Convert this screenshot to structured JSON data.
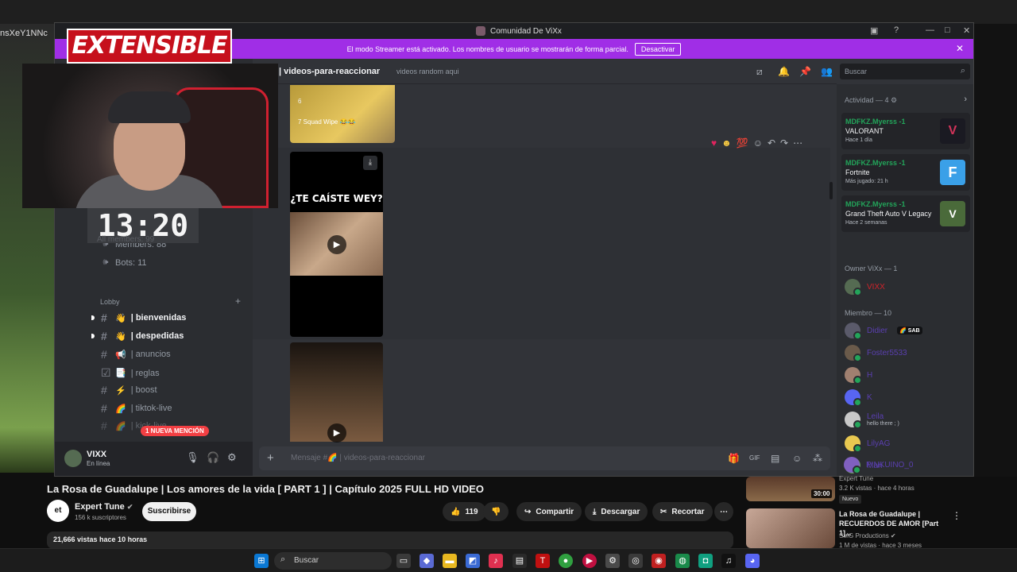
{
  "background": {
    "left_text": "nsXeY1NNc"
  },
  "discord": {
    "window_title": "Comunidad De ViXx",
    "streamer_banner": {
      "text": "El modo Streamer está activado. Los nombres de usuario se mostrarán de forma parcial.",
      "button": "Desactivar"
    },
    "channel_header": {
      "name": "| videos-para-reaccionar",
      "topic": "videos random aqui"
    },
    "search_placeholder": "Buscar",
    "sidebar": {
      "counts": [
        "All members: 99",
        "Members: 88",
        "Bots: 11"
      ],
      "category": "Lobby",
      "channels": [
        {
          "label": "| bienvenidas",
          "emoji": "👋"
        },
        {
          "label": "| despedidas",
          "emoji": "👋"
        },
        {
          "label": "| anuncios",
          "emoji": "📢"
        },
        {
          "label": "| reglas",
          "emoji": "📑"
        },
        {
          "label": "| boost",
          "emoji": "⚡"
        },
        {
          "label": "| tiktok-live",
          "emoji": "🌈"
        },
        {
          "label": "| kick-live",
          "emoji": "🌈"
        }
      ],
      "mention_badge": "1 NUEVA MENCIÓN"
    },
    "user": {
      "name": "VIXX",
      "status": "En línea"
    },
    "messages": {
      "media1_caption": "7 Squad Wipe 😂😂",
      "media1_num": "6",
      "media2_caption": "¿TE CAÍSTE WEY?"
    },
    "composer_placeholder": "Mensaje #🌈 | videos-para-reaccionar",
    "member_list": {
      "activity_header": "Actividad — 4",
      "activities": [
        {
          "user": "MDFKZ.Myerss -1",
          "game": "VALORANT",
          "when": "Hace 1 día",
          "color": "#d2345a"
        },
        {
          "user": "MDFKZ.Myerss -1",
          "game": "Fortnite",
          "when": "Más jugado: 21 h",
          "color": "#3aa0e8"
        },
        {
          "user": "MDFKZ.Myerss -1",
          "game": "Grand Theft Auto V Legacy",
          "when": "Hace 2 semanas",
          "color": "#4a6a3a"
        }
      ],
      "owner_header": "Owner ViXx — 1",
      "owner": "VIXX",
      "member_header": "Miembro — 10",
      "members": [
        {
          "name": "Didier",
          "sub": "",
          "color": "#5a5a6a"
        },
        {
          "name": "Foster5533",
          "sub": "",
          "color": "#6a5a4a"
        },
        {
          "name": "H",
          "sub": "",
          "color": "#a08070"
        },
        {
          "name": "K",
          "sub": "",
          "color": "#5865f2"
        },
        {
          "name": "Leila",
          "sub": "hello there ; )",
          "color": "#c8c8c8"
        },
        {
          "name": "LilyAG",
          "sub": "",
          "color": "#e8c850"
        },
        {
          "name": "Mari",
          "sub": "",
          "color": "#6aa060"
        },
        {
          "name": "PINKUINO_0",
          "sub": "",
          "color": "#8060c0"
        }
      ]
    }
  },
  "overlay": {
    "brand": "EXTENSIBLE",
    "clock": "13:20"
  },
  "youtube": {
    "title": "La Rosa de Guadalupe | Los amores de la vida [ PART 1 ] | Capítulo 2025 FULL HD VIDEO",
    "channel": "Expert Tune",
    "channel_avatar": "et",
    "subscribers": "156 k suscriptores",
    "subscribe": "Suscribirse",
    "likes": "119",
    "share": "Compartir",
    "download": "Descargar",
    "clip": "Recortar",
    "views": "21,666 vistas  hace 10 horas",
    "recs": [
      {
        "channel": "Expert Tune",
        "meta": "3.2 K vistas · hace 4 horas",
        "badge": "Nuevo",
        "duration": "30:00"
      },
      {
        "title": "La Rosa de Guadalupe | RECUERDOS DE AMOR [Part 1]...",
        "channel": "SMG Productions",
        "meta": "1 M de vistas · hace 3 meses"
      }
    ]
  },
  "taskbar": {
    "search": "Buscar"
  }
}
